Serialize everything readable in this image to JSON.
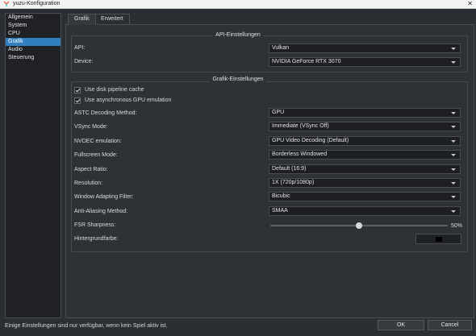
{
  "window": {
    "title": "yuzu-Konfiguration"
  },
  "sidebar": {
    "items": [
      {
        "label": "Allgemein",
        "active": false
      },
      {
        "label": "System",
        "active": false
      },
      {
        "label": "CPU",
        "active": false
      },
      {
        "label": "Grafik",
        "active": true
      },
      {
        "label": "Audio",
        "active": false
      },
      {
        "label": "Steuerung",
        "active": false
      }
    ]
  },
  "tabs": [
    {
      "label": "Grafik",
      "active": true
    },
    {
      "label": "Erweitert",
      "active": false
    }
  ],
  "api_settings": {
    "title": "API-Einstellungen",
    "api": {
      "label": "API:",
      "value": "Vulkan"
    },
    "device": {
      "label": "Device:",
      "value": "NVIDIA GeForce RTX 3070"
    }
  },
  "graphics_settings": {
    "title": "Grafik-Einstellungen",
    "checkboxes": [
      {
        "label": "Use disk pipeline cache",
        "checked": true
      },
      {
        "label": "Use asynchronous GPU emulation",
        "checked": true
      }
    ],
    "astc": {
      "label": "ASTC Decoding Method:",
      "value": "GPU"
    },
    "vsync": {
      "label": "VSync Mode:",
      "value": "Immediate (VSync Off)"
    },
    "nvdec": {
      "label": "NVDEC emulation:",
      "value": "GPU Video Decoding (Default)"
    },
    "fullscreen": {
      "label": "Fullscreen Mode:",
      "value": "Borderless Windowed"
    },
    "aspect": {
      "label": "Aspect Ratio:",
      "value": "Default (16:9)"
    },
    "resolution": {
      "label": "Resolution:",
      "value": "1X (720p/1080p)"
    },
    "filter": {
      "label": "Window Adapting Filter:",
      "value": "Bicubic"
    },
    "antialiasing": {
      "label": "Anti-Aliasing Method:",
      "value": "SMAA"
    },
    "fsr": {
      "label": "FSR Sharpness:",
      "value_text": "50%",
      "value": 0.5
    },
    "background": {
      "label": "Hintergrundfarbe:",
      "color": "#000000"
    }
  },
  "footer": {
    "note": "Einige Einstellungen sind nur verfügbar, wenn kein Spiel aktiv ist.",
    "ok_label": "OK",
    "cancel_label": "Cancel"
  },
  "colors": {
    "accent": "#2f7fc1",
    "background": "#2b2e32"
  }
}
